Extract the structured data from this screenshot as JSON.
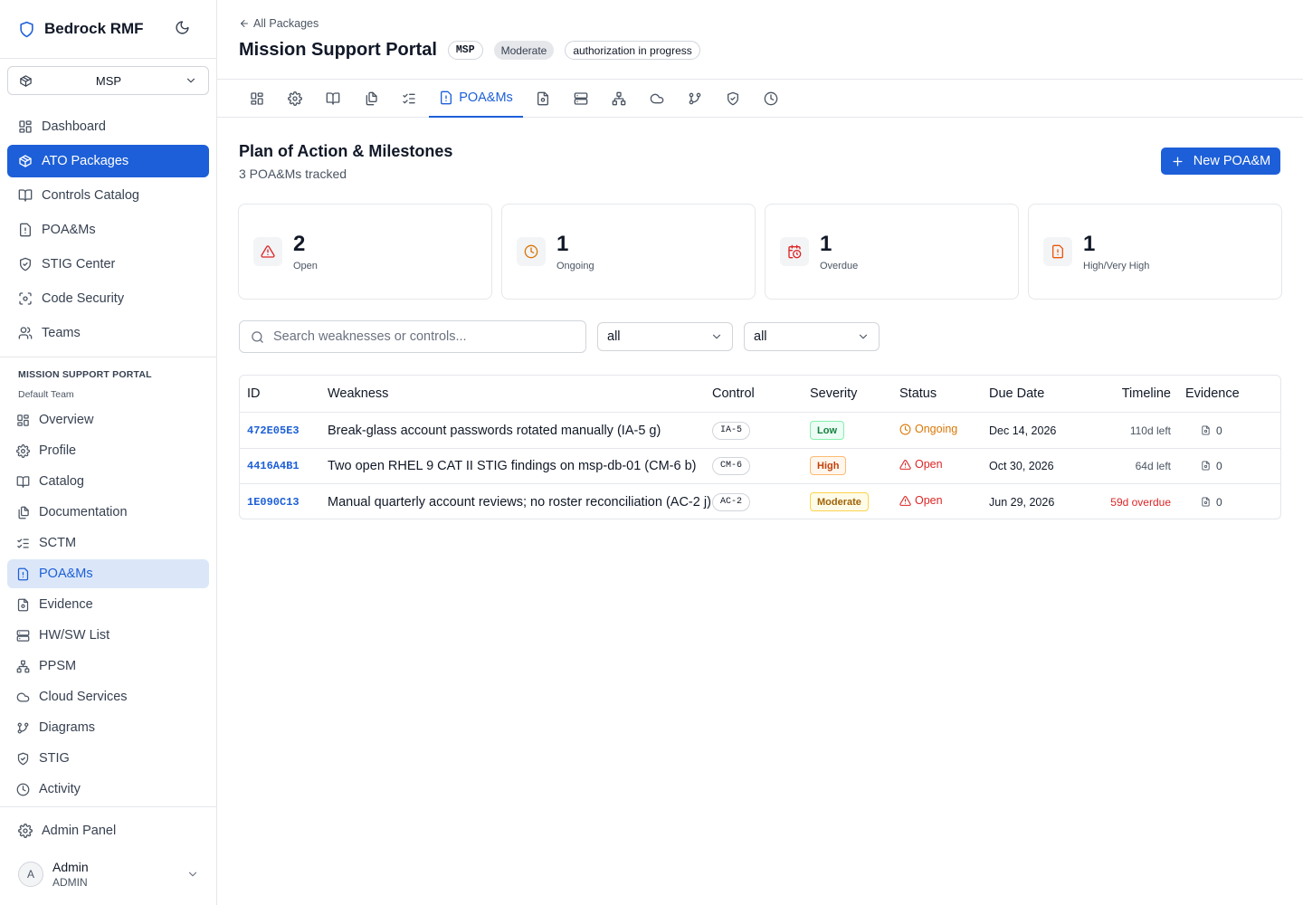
{
  "brand": {
    "name": "Bedrock RMF",
    "logo_icon": "shield-icon",
    "theme_icon": "moon-icon"
  },
  "package_selector": {
    "value": "MSP"
  },
  "nav": [
    {
      "label": "Dashboard",
      "icon": "dashboard-icon",
      "active": false
    },
    {
      "label": "ATO Packages",
      "icon": "package-icon",
      "active": true
    },
    {
      "label": "Controls Catalog",
      "icon": "book-icon",
      "active": false
    },
    {
      "label": "POA&Ms",
      "icon": "file-alert-icon",
      "active": false
    },
    {
      "label": "STIG Center",
      "icon": "shield-check-icon",
      "active": false
    },
    {
      "label": "Code Security",
      "icon": "scan-icon",
      "active": false
    },
    {
      "label": "Teams",
      "icon": "users-icon",
      "active": false
    }
  ],
  "package_section": {
    "title": "MISSION SUPPORT PORTAL",
    "team": "Default Team"
  },
  "subnav": [
    {
      "label": "Overview",
      "icon": "dashboard-icon"
    },
    {
      "label": "Profile",
      "icon": "gear-icon"
    },
    {
      "label": "Catalog",
      "icon": "book-icon"
    },
    {
      "label": "Documentation",
      "icon": "files-icon"
    },
    {
      "label": "SCTM",
      "icon": "checklist-icon"
    },
    {
      "label": "POA&Ms",
      "icon": "file-alert-icon",
      "selected": true
    },
    {
      "label": "Evidence",
      "icon": "file-icon"
    },
    {
      "label": "HW/SW List",
      "icon": "server-icon"
    },
    {
      "label": "PPSM",
      "icon": "network-icon"
    },
    {
      "label": "Cloud Services",
      "icon": "cloud-icon"
    },
    {
      "label": "Diagrams",
      "icon": "git-branch-icon"
    },
    {
      "label": "STIG",
      "icon": "shield-check-icon"
    },
    {
      "label": "Activity",
      "icon": "clock-icon"
    }
  ],
  "admin_panel": {
    "label": "Admin Panel",
    "icon": "gear-icon"
  },
  "user": {
    "initial": "A",
    "name": "Admin",
    "role": "ADMIN"
  },
  "header": {
    "back_label": "All Packages",
    "title": "Mission Support Portal",
    "badges": [
      "MSP",
      "Moderate",
      "authorization in progress"
    ]
  },
  "tabs": [
    {
      "icon": "dashboard-icon",
      "label": ""
    },
    {
      "icon": "gear-icon",
      "label": ""
    },
    {
      "icon": "book-icon",
      "label": ""
    },
    {
      "icon": "files-icon",
      "label": ""
    },
    {
      "icon": "checklist-icon",
      "label": ""
    },
    {
      "icon": "file-alert-icon",
      "label": "POA&Ms",
      "active": true
    },
    {
      "icon": "file-icon",
      "label": ""
    },
    {
      "icon": "server-icon",
      "label": ""
    },
    {
      "icon": "network-icon",
      "label": ""
    },
    {
      "icon": "cloud-icon",
      "label": ""
    },
    {
      "icon": "git-branch-icon",
      "label": ""
    },
    {
      "icon": "shield-check-icon",
      "label": ""
    },
    {
      "icon": "clock-icon",
      "label": ""
    }
  ],
  "section": {
    "title": "Plan of Action & Milestones",
    "subtitle": "3 POA&Ms tracked",
    "new_button": "New POA&M"
  },
  "stats": [
    {
      "value": "2",
      "label": "Open",
      "icon": "alert-triangle-icon",
      "color": "#dc2626"
    },
    {
      "value": "1",
      "label": "Ongoing",
      "icon": "clock-icon",
      "color": "#d97706"
    },
    {
      "value": "1",
      "label": "Overdue",
      "icon": "calendar-clock-icon",
      "color": "#dc2626"
    },
    {
      "value": "1",
      "label": "High/Very High",
      "icon": "file-alert-icon",
      "color": "#ea580c"
    }
  ],
  "filters": {
    "search_placeholder": "Search weaknesses or controls...",
    "status": "all",
    "severity": "all"
  },
  "table": {
    "headers": [
      "ID",
      "Weakness",
      "Control",
      "Severity",
      "Status",
      "Due Date",
      "Timeline",
      "Evidence"
    ],
    "rows": [
      {
        "id": "472E05E3",
        "weakness": "Break-glass account passwords rotated manually (IA-5 g)",
        "control": "IA-5",
        "severity": "Low",
        "status": "Ongoing",
        "due": "Dec 14, 2026",
        "timeline": "110d left",
        "evidence": "0"
      },
      {
        "id": "4416A4B1",
        "weakness": "Two open RHEL 9 CAT II STIG findings on msp-db-01 (CM-6 b)",
        "control": "CM-6",
        "severity": "High",
        "status": "Open",
        "due": "Oct 30, 2026",
        "timeline": "64d left",
        "evidence": "0"
      },
      {
        "id": "1E090C13",
        "weakness": "Manual quarterly account reviews; no roster reconciliation (AC-2 j)",
        "control": "AC-2",
        "severity": "Moderate",
        "status": "Open",
        "due": "Jun 29, 2026",
        "timeline": "59d overdue",
        "evidence": "0"
      }
    ]
  },
  "colors": {
    "accent": "#1d5fd8",
    "danger": "#dc2626",
    "warning": "#d97706"
  }
}
